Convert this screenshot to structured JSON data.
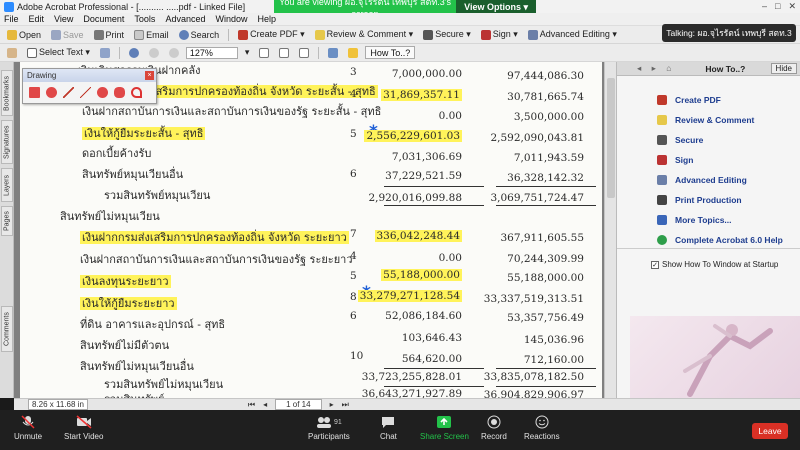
{
  "app": {
    "title": "Adobe Acrobat Professional - [.......... .....pdf - Linked File]",
    "win_controls": [
      "–",
      "□",
      "✕"
    ]
  },
  "zoom": {
    "share_text": "You are viewing ผอ.จุไรรัตน์ เทพบุรี สตท.3's screen",
    "view_options": "View Options ▾",
    "talking": "Talking: ผอ.จุไรรัตน์ เทพบุรี สตท.3",
    "participant_count": "91",
    "controls": [
      "Unmute",
      "Start Video",
      "Participants",
      "Chat",
      "Share Screen",
      "Record",
      "Reactions"
    ],
    "leave": "Leave"
  },
  "menu": [
    "File",
    "Edit",
    "View",
    "Document",
    "Tools",
    "Advanced",
    "Window",
    "Help"
  ],
  "toolbar1": {
    "open": "Open",
    "save": "Save",
    "print": "Print",
    "email": "Email",
    "search": "Search",
    "create_pdf": "Create PDF ▾",
    "review": "Review & Comment ▾",
    "secure": "Secure ▾",
    "sign": "Sign ▾",
    "advanced": "Advanced Editing ▾"
  },
  "toolbar2": {
    "select_text": "Select Text ▾",
    "zoom": "127%",
    "chevron": "▾",
    "how_to": "How To..?"
  },
  "left_tabs": [
    "Bookmarks",
    "Signatures",
    "Layers",
    "Pages",
    "Comments"
  ],
  "drawing": {
    "title": "Drawing",
    "close": "×"
  },
  "doc": {
    "star": "*",
    "notes": [
      "3",
      "4",
      "5",
      "6",
      "7",
      "4",
      "5",
      "8",
      "6",
      "10"
    ],
    "rows": [
      {
        "label": "เงินเกินสกรรมเงินฝากคลัง",
        "cur": "7,000,000.00",
        "prev": "97,444,086.30"
      },
      {
        "label": "เงินฝากกรมส่งเสริมการปกครองท้องถิ่น จังหวัด ระยะสั้น - สุทธิ",
        "cur": "31,869,357.11",
        "prev": "30,781,665.74"
      },
      {
        "label": "เงินฝากสถาบันการเงินและสถาบันการเงินของรัฐ ระยะสั้น - สุทธิ",
        "cur": "0.00",
        "prev": "3,500,000.00"
      },
      {
        "label": "เงินให้กู้ยืมระยะสั้น - สุทธิ",
        "cur": "2,556,229,601.03",
        "prev": "2,592,090,043.81"
      },
      {
        "label": "ดอกเบี้ยค้างรับ",
        "cur": "7,031,306.69",
        "prev": "7,011,943.59"
      },
      {
        "label": "สินทรัพย์หมุนเวียนอื่น",
        "cur": "37,229,521.59",
        "prev": "36,328,142.32"
      },
      {
        "label": "รวมสินทรัพย์หมุนเวียน",
        "cur": "2,920,016,099.88",
        "prev": "3,069,751,724.47"
      },
      {
        "label": "สินทรัพย์ไม่หมุนเวียน"
      },
      {
        "label": "เงินฝากกรมส่งเสริมการปกครองท้องถิ่น จังหวัด ระยะยาว",
        "cur": "336,042,248.44",
        "prev": "367,911,605.55"
      },
      {
        "label": "เงินฝากสถาบันการเงินและสถาบันการเงินของรัฐ ระยะยาว",
        "cur": "0.00",
        "prev": "70,244,309.99"
      },
      {
        "label": "เงินลงทุนระยะยาว",
        "cur": "55,188,000.00",
        "prev": "55,188,000.00"
      },
      {
        "label": "เงินให้กู้ยืมระยะยาว",
        "cur": "33,279,271,128.54",
        "prev": "33,337,519,313.51"
      },
      {
        "label": "ที่ดิน อาคารและอุปกรณ์ - สุทธิ",
        "cur": "52,086,184.60",
        "prev": "53,357,756.49"
      },
      {
        "label": "สินทรัพย์ไม่มีตัวตน",
        "cur": "103,646.43",
        "prev": "145,036.96"
      },
      {
        "label": "สินทรัพย์ไม่หมุนเวียนอื่น",
        "cur": "564,620.00",
        "prev": "712,160.00"
      },
      {
        "label": "รวมสินทรัพย์ไม่หมุนเวียน",
        "cur": "33,723,255,828.01",
        "prev": "33,835,078,182.50"
      },
      {
        "label": "รวมสินทรัพย์",
        "cur": "36,643,271,927.89",
        "prev": "36,904,829,906.97"
      }
    ]
  },
  "howto": {
    "nav": "◂ ▸ ⌂",
    "title": "How To..?",
    "hide": "Hide",
    "items": [
      "Create PDF",
      "Review & Comment",
      "Secure",
      "Sign",
      "Advanced Editing",
      "Print Production",
      "More Topics...",
      "Complete Acrobat 6.0 Help"
    ],
    "checkmark": "✓",
    "checkbox_label": "Show How To Window at Startup"
  },
  "status": {
    "page_size": "8.26 x 11.68 in",
    "first": "⏮",
    "prev": "◂",
    "page": "1 of 14",
    "next": "▸",
    "last": "⏭"
  }
}
